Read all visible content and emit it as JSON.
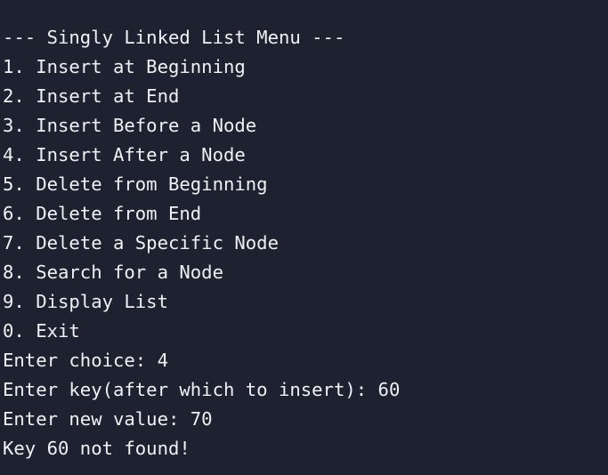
{
  "terminal": {
    "lines": [
      "--- Singly Linked List Menu ---",
      "1. Insert at Beginning",
      "2. Insert at End",
      "3. Insert Before a Node",
      "4. Insert After a Node",
      "5. Delete from Beginning",
      "6. Delete from End",
      "7. Delete a Specific Node",
      "8. Search for a Node",
      "9. Display List",
      "0. Exit",
      "Enter choice: 4",
      "Enter key(after which to insert): 60",
      "Enter new value: 70",
      "Key 60 not found!"
    ]
  }
}
